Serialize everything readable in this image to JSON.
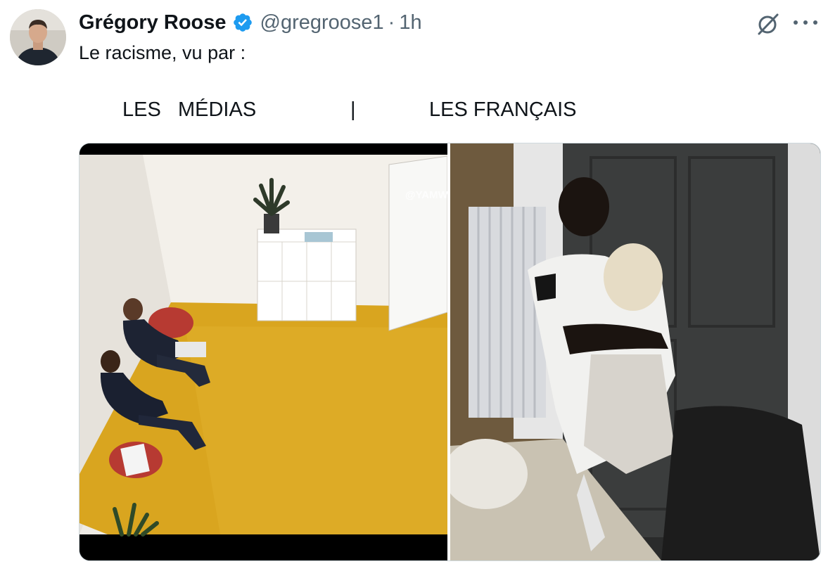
{
  "tweet": {
    "author_name": "Grégory Roose",
    "handle": "@gregroose1",
    "separator": "·",
    "time": "1h",
    "text": "Le racisme, vu par :"
  },
  "caption": {
    "left": "LES   MÉDIAS",
    "bar": "|",
    "right": "LES FRANÇAIS"
  },
  "media": {
    "left_watermark": "@YAMW"
  },
  "icons": {
    "avatar": "avatar-photo",
    "verified": "verified-badge-icon",
    "grok": "grok-icon",
    "more": "more-icon"
  },
  "colors": {
    "verified_blue": "#1d9bf0",
    "secondary_text": "#536471",
    "floor_yellow": "#d9a51f"
  }
}
